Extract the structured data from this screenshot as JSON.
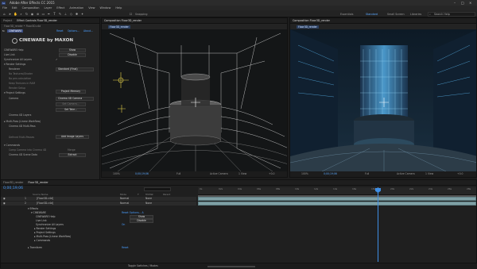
{
  "app": {
    "title": "Adobe After Effects CC 2015",
    "window_controls": [
      "–",
      "□",
      "×"
    ]
  },
  "menu": [
    "File",
    "Edit",
    "Composition",
    "Layer",
    "Effect",
    "Animation",
    "View",
    "Window",
    "Help"
  ],
  "toolbar": {
    "snapping": "Snapping",
    "workspaces": [
      "Essentials",
      "Standard",
      "Small Screen",
      "Libraries"
    ],
    "active_workspace": "Standard",
    "search_placeholder": "Search Help"
  },
  "left_panel": {
    "tabs": [
      "Project",
      "Effect Controls Floor3D_render"
    ],
    "breadcrumb": "Floor3D_render • Floor3D.c4d",
    "effect_name": "CINEWARE",
    "effect_links": [
      "Reset",
      "Options...",
      "About..."
    ],
    "logo": "CINEWARE by MAXON",
    "rows": [
      {
        "label": "CINEWARE Help",
        "value": "Show"
      },
      {
        "label": "Live Link",
        "value": "Disable"
      },
      {
        "label": "Synchronize All Layers",
        "value": "✓"
      },
      {
        "label": "▾ Render Settings",
        "value": ""
      },
      {
        "label": "Renderer",
        "value": "Standard (Final)"
      },
      {
        "label": "No Textures/Shader",
        "value": ""
      },
      {
        "label": "No pre-calculation",
        "value": ""
      },
      {
        "label": "Keep Textures in RAM",
        "value": ""
      },
      {
        "label": "Render Setup",
        "value": ""
      },
      {
        "label": "▾ Project Settings",
        "value": "Project Memory"
      },
      {
        "label": "Camera",
        "value": "Cinema 4D Camera"
      },
      {
        "label": "",
        "value": "Set Camera..."
      },
      {
        "label": "Cinema 4D Layers",
        "value": ""
      },
      {
        "label": "▸ Multi-Pass (Linear Workflow)",
        "value": ""
      },
      {
        "label": "Cinema 4D Multi-Pass",
        "value": ""
      },
      {
        "label": "Defined Multi-Passes",
        "value": ""
      },
      {
        "label": "",
        "value": "Add Image Layers"
      },
      {
        "label": "▾ Commands",
        "value": ""
      },
      {
        "label": "Comp Camera into Cinema 4D",
        "value": "Merge"
      },
      {
        "label": "Cinema 4D Scene Data",
        "value": "Extract"
      }
    ],
    "buttons": {
      "show": "Show",
      "disable": "Disable",
      "set_camera": "Set Take...",
      "add_image_layers": "Add Image Layers",
      "extract": "Extract"
    }
  },
  "comp_left": {
    "tab": "Composition Floor3D_render",
    "label": "Floor3D_render",
    "bottom": {
      "zoom": "100%",
      "time": "0;00;19;06",
      "quality": "Full",
      "camera": "Active Camera",
      "views": "1 View",
      "exposure": "+0.0"
    }
  },
  "comp_right": {
    "tab": "Composition Floor3D_render",
    "label": "Floor3D_render",
    "bottom": {
      "zoom": "100%",
      "time": "0;00;19;06",
      "quality": "Full",
      "camera": "Active Camera",
      "views": "1 View",
      "exposure": "+0.0"
    }
  },
  "timeline": {
    "tabs": [
      "Floor3D_render",
      "Floor3D_render"
    ],
    "timecode": "0;00;19;06",
    "columns": [
      "Source Name",
      "Mode",
      "T",
      "TrkMat",
      "Parent"
    ],
    "layers": [
      {
        "num": "1",
        "name": "[Floor3D.c4d]",
        "mode": "Normal",
        "parent": "None"
      },
      {
        "num": "2",
        "name": "[Floor3D.c4d]",
        "mode": "Normal",
        "parent": "None"
      }
    ],
    "props": [
      {
        "label": "▾ Effects",
        "value": ""
      },
      {
        "label": "▾ CINEWARE",
        "value": "Reset   Options...   A"
      },
      {
        "label": "CINEWARE Help",
        "value": "Show"
      },
      {
        "label": "Live Link",
        "value": "Disable"
      },
      {
        "label": "Synchronize All Layers",
        "value": "On"
      },
      {
        "label": "▸ Render Settings",
        "value": ""
      },
      {
        "label": "▸ Project Settings",
        "value": ""
      },
      {
        "label": "▸ Multi-Pass (Linear Workflow)",
        "value": ""
      },
      {
        "label": "▸ Commands",
        "value": ""
      },
      {
        "label": "▸ Transform",
        "value": "Reset"
      }
    ],
    "ruler": [
      "0s",
      "02s",
      "04s",
      "06s",
      "08s",
      "10s",
      "12s",
      "14s",
      "16s",
      "18s",
      "20s",
      "22s",
      "24s",
      "26s",
      "28s"
    ],
    "footer": "Toggle Switches / Modes"
  },
  "colors": {
    "accent": "#4a9eff",
    "layer_bar": "#7fa0a5",
    "playhead": "#3f8fe5"
  }
}
